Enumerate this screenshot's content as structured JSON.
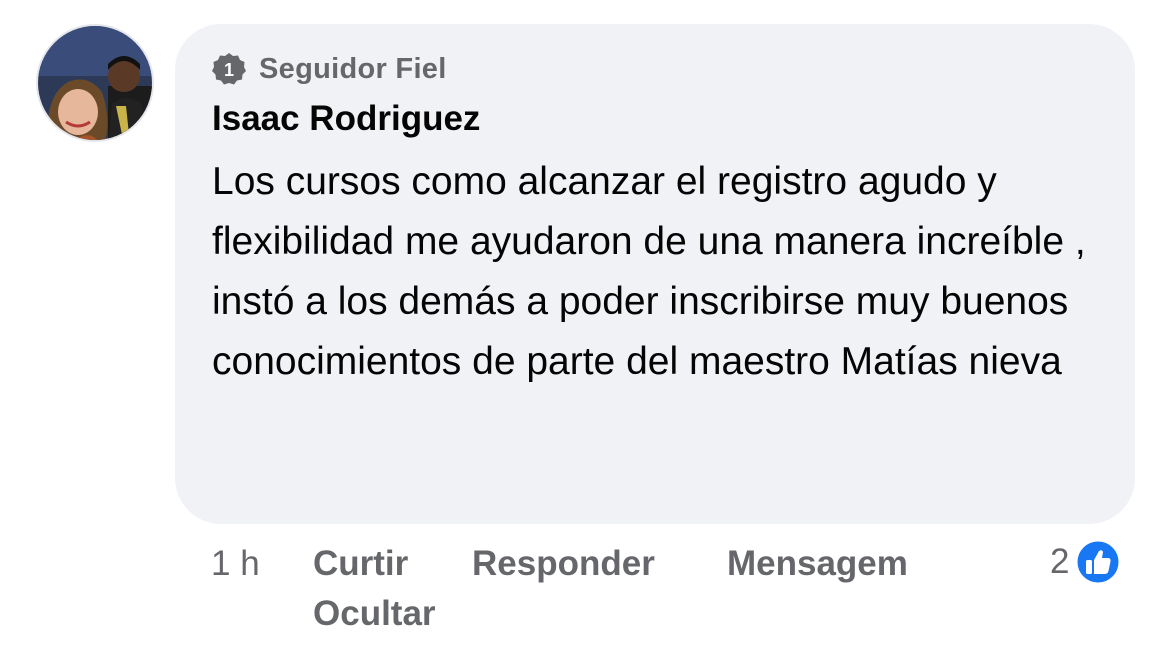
{
  "comment": {
    "badge": {
      "label": "Seguidor Fiel",
      "icon": "badge-one-icon"
    },
    "author": "Isaac Rodriguez",
    "text": "Los cursos como alcanzar el registro agudo y flexibilidad me ayudaron de una manera increíble , instó a los demás a poder inscribirse muy buenos conocimientos de parte del maestro Matías nieva",
    "avatar_icon": "profile-photo"
  },
  "actions": {
    "time": "1 h",
    "like": "Curtir",
    "reply": "Responder",
    "message": "Mensagem",
    "hide": "Ocultar"
  },
  "reactions": {
    "count": "2",
    "icon": "like-reaction-icon",
    "color": "#1877f2"
  },
  "colors": {
    "bubble": "#f0f2f5",
    "secondary_text": "#65676b",
    "primary_text": "#050505"
  }
}
